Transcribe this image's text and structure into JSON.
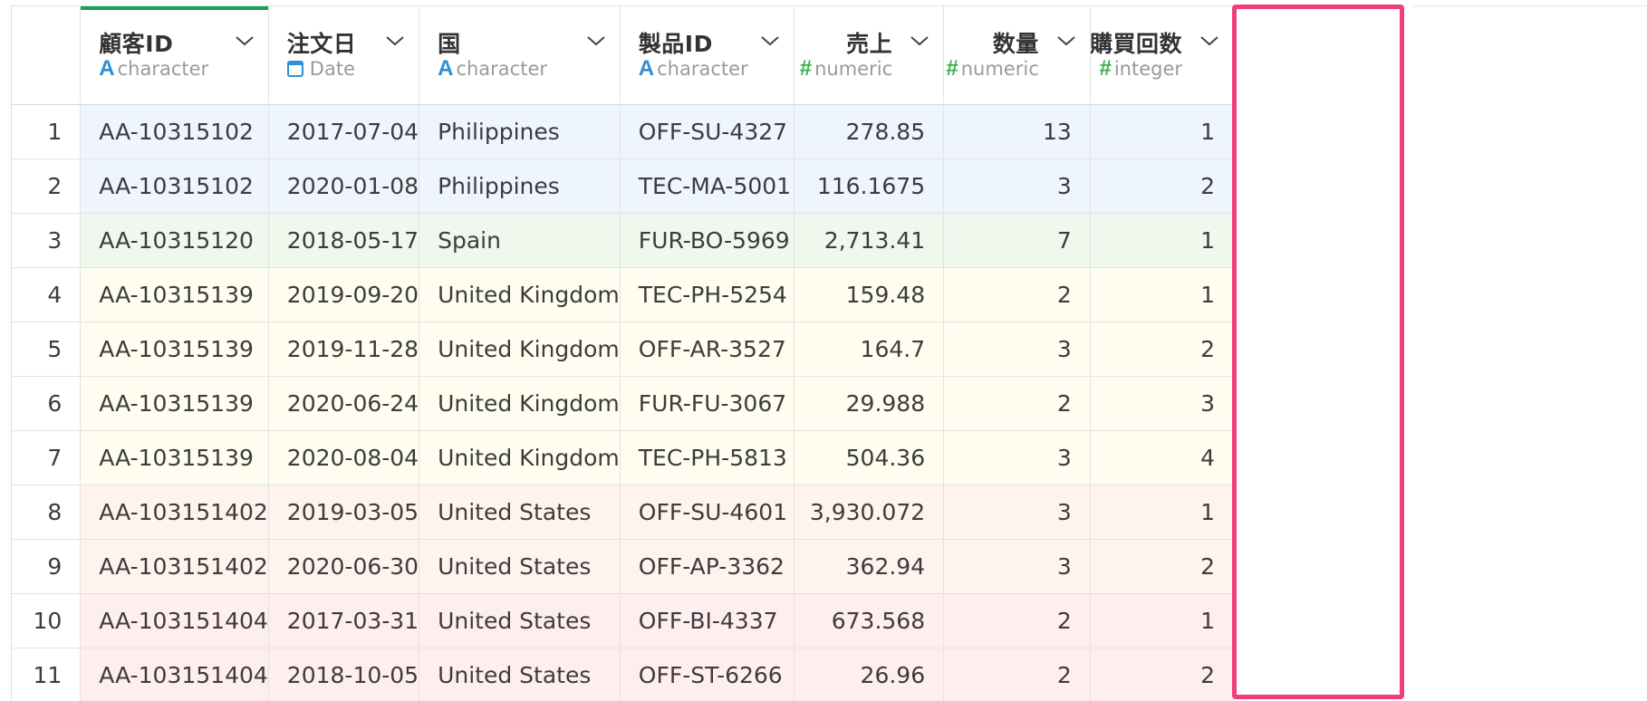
{
  "columns": [
    {
      "name": "顧客ID",
      "type": "character",
      "icon": "A",
      "align": "left"
    },
    {
      "name": "注文日",
      "type": "Date",
      "icon": "calendar",
      "align": "left"
    },
    {
      "name": "国",
      "type": "character",
      "icon": "A",
      "align": "left"
    },
    {
      "name": "製品ID",
      "type": "character",
      "icon": "A",
      "align": "left"
    },
    {
      "name": "売上",
      "type": "numeric",
      "icon": "#",
      "align": "right"
    },
    {
      "name": "数量",
      "type": "numeric",
      "icon": "#",
      "align": "right"
    },
    {
      "name": "購買回数",
      "type": "integer",
      "icon": "#",
      "align": "right"
    }
  ],
  "rows": [
    {
      "idx": "1",
      "cells": [
        "AA-10315102",
        "2017-07-04",
        "Philippines",
        "OFF-SU-4327",
        "278.85",
        "13",
        "1"
      ],
      "color": "#eef5ff"
    },
    {
      "idx": "2",
      "cells": [
        "AA-10315102",
        "2020-01-08",
        "Philippines",
        "TEC-MA-5001",
        "116.1675",
        "3",
        "2"
      ],
      "color": "#eef5ff"
    },
    {
      "idx": "3",
      "cells": [
        "AA-10315120",
        "2018-05-17",
        "Spain",
        "FUR-BO-5969",
        "2,713.41",
        "7",
        "1"
      ],
      "color": "#f0f8ee"
    },
    {
      "idx": "4",
      "cells": [
        "AA-10315139",
        "2019-09-20",
        "United Kingdom",
        "TEC-PH-5254",
        "159.48",
        "2",
        "1"
      ],
      "color": "#fefdf0"
    },
    {
      "idx": "5",
      "cells": [
        "AA-10315139",
        "2019-11-28",
        "United Kingdom",
        "OFF-AR-3527",
        "164.7",
        "3",
        "2"
      ],
      "color": "#fefdf0"
    },
    {
      "idx": "6",
      "cells": [
        "AA-10315139",
        "2020-06-24",
        "United Kingdom",
        "FUR-FU-3067",
        "29.988",
        "2",
        "3"
      ],
      "color": "#fefdf0"
    },
    {
      "idx": "7",
      "cells": [
        "AA-10315139",
        "2020-08-04",
        "United Kingdom",
        "TEC-PH-5813",
        "504.36",
        "3",
        "4"
      ],
      "color": "#fefdf0"
    },
    {
      "idx": "8",
      "cells": [
        "AA-103151402",
        "2019-03-05",
        "United States",
        "OFF-SU-4601",
        "3,930.072",
        "3",
        "1"
      ],
      "color": "#fff4ed"
    },
    {
      "idx": "9",
      "cells": [
        "AA-103151402",
        "2020-06-30",
        "United States",
        "OFF-AP-3362",
        "362.94",
        "3",
        "2"
      ],
      "color": "#fff4ed"
    },
    {
      "idx": "10",
      "cells": [
        "AA-103151404",
        "2017-03-31",
        "United States",
        "OFF-BI-4337",
        "673.568",
        "2",
        "1"
      ],
      "color": "#ffeef0"
    },
    {
      "idx": "11",
      "cells": [
        "AA-103151404",
        "2018-10-05",
        "United States",
        "OFF-ST-6266",
        "26.96",
        "2",
        "2"
      ],
      "color": "#ffeef0"
    }
  ],
  "selected_column": "顧客ID",
  "highlighted_column": "購買回数",
  "colors": {
    "highlight_border": "#f03e7a",
    "selected_bar": "#16a05d",
    "icon_text": "#2f8fd5",
    "icon_numeric": "#3cae4f"
  }
}
